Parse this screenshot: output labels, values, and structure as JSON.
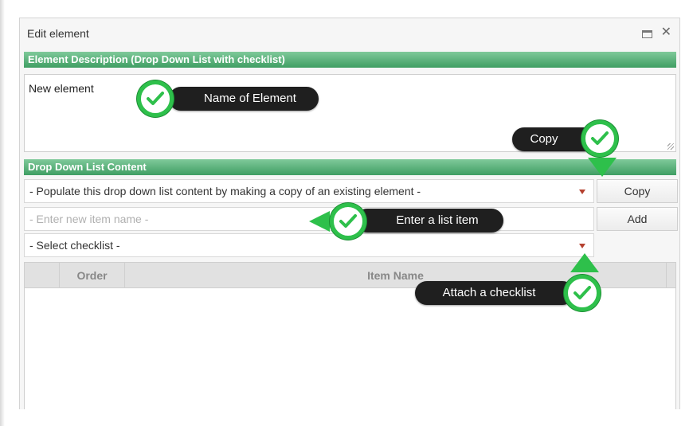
{
  "window": {
    "title": "Edit element",
    "maximize_icon": "maximize-icon",
    "close_glyph": "✕"
  },
  "description_section": {
    "header": "Element Description (Drop Down List with checklist)",
    "value": "New element"
  },
  "list_section": {
    "header": "Drop Down List Content",
    "populate_select": "- Populate this drop down list content by making a copy of an existing element -",
    "copy_button": "Copy",
    "new_item_placeholder": "- Enter new item name -",
    "add_button": "Add",
    "checklist_select": "- Select checklist -"
  },
  "table": {
    "columns": [
      "Order",
      "Item Name"
    ]
  },
  "callouts": {
    "name_of_element": "Name of Element",
    "copy": "Copy",
    "enter_list_item": "Enter a list item",
    "attach_checklist": "Attach a checklist"
  },
  "colors": {
    "accent_green": "#2ec04b",
    "header_green": "#3f9e63",
    "callout_bg": "#1f1f1f",
    "caret_red": "#b5412f"
  }
}
